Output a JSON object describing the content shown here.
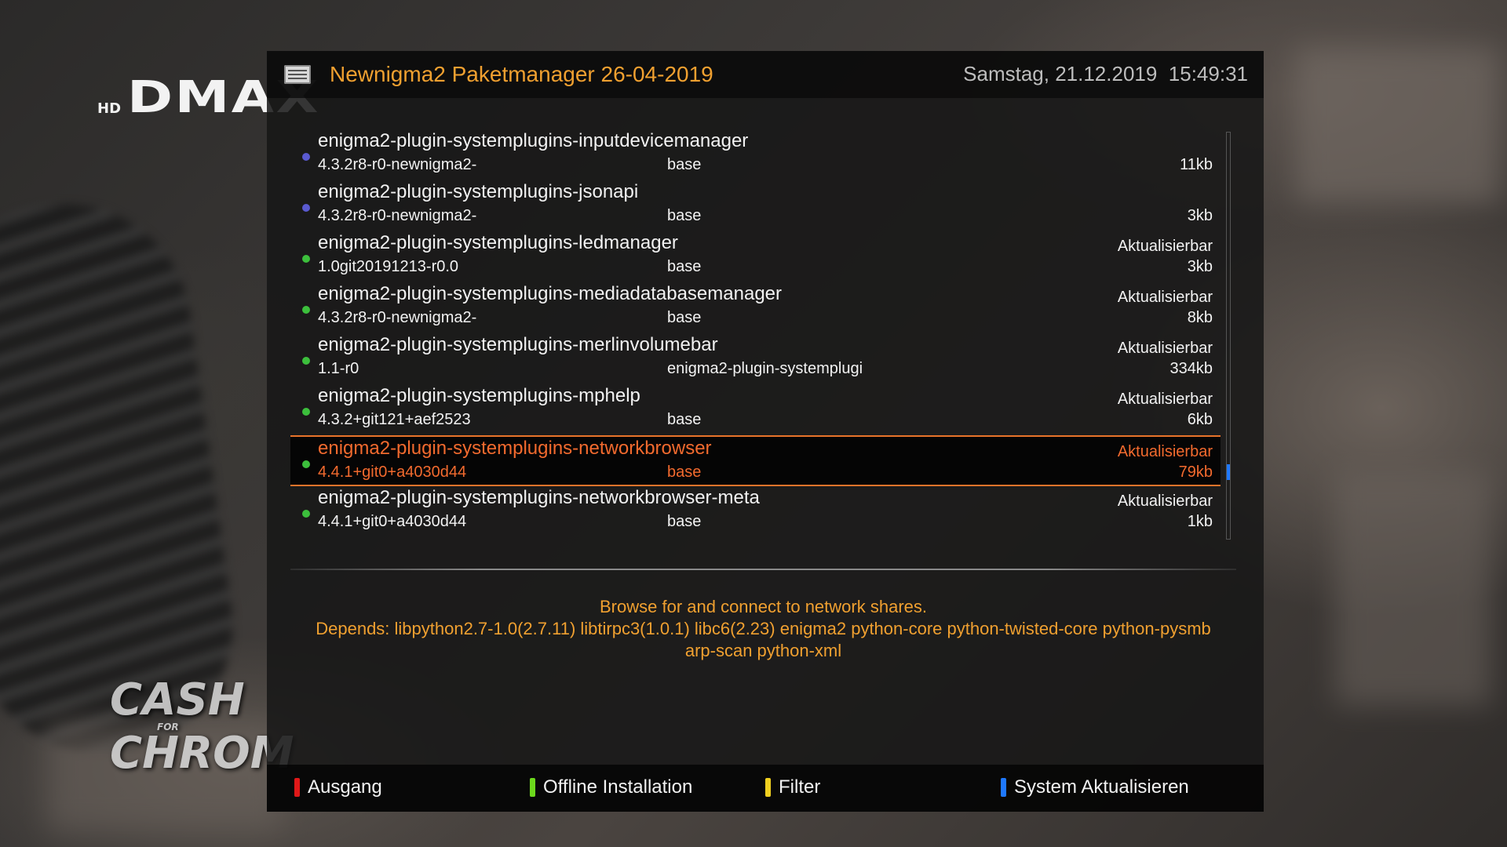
{
  "channel": {
    "hd_label": "HD",
    "brand": "DMAX",
    "show_logo_top": "CASH",
    "show_logo_small": "FOR",
    "show_logo_bottom": "CHROM"
  },
  "header": {
    "title": "Newnigma2 Paketmanager 26-04-2019",
    "date": "Samstag, 21.12.2019",
    "time": "15:49:31",
    "icon": "document-icon"
  },
  "packages": [
    {
      "name": "enigma2-plugin-systemplugins-inputdevicemanager",
      "version": "4.3.2r8-r0-newnigma2-",
      "section": "base",
      "status": "",
      "size": "11kb",
      "dot_color": "#5a5ad0"
    },
    {
      "name": "enigma2-plugin-systemplugins-jsonapi",
      "version": "4.3.2r8-r0-newnigma2-",
      "section": "base",
      "status": "",
      "size": "3kb",
      "dot_color": "#5a5ad0"
    },
    {
      "name": "enigma2-plugin-systemplugins-ledmanager",
      "version": "1.0git20191213-r0.0",
      "section": "base",
      "status": "Aktualisierbar",
      "size": "3kb",
      "dot_color": "#3cbf3c"
    },
    {
      "name": "enigma2-plugin-systemplugins-mediadatabasemanager",
      "version": "4.3.2r8-r0-newnigma2-",
      "section": "base",
      "status": "Aktualisierbar",
      "size": "8kb",
      "dot_color": "#3cbf3c"
    },
    {
      "name": "enigma2-plugin-systemplugins-merlinvolumebar",
      "version": "1.1-r0",
      "section": "enigma2-plugin-systemplugi",
      "status": "Aktualisierbar",
      "size": "334kb",
      "dot_color": "#3cbf3c"
    },
    {
      "name": "enigma2-plugin-systemplugins-mphelp",
      "version": "4.3.2+git121+aef2523",
      "section": "base",
      "status": "Aktualisierbar",
      "size": "6kb",
      "dot_color": "#3cbf3c"
    },
    {
      "name": "enigma2-plugin-systemplugins-networkbrowser",
      "version": "4.4.1+git0+a4030d44",
      "section": "base",
      "status": "Aktualisierbar",
      "size": "79kb",
      "dot_color": "#3cbf3c",
      "selected": true
    },
    {
      "name": "enigma2-plugin-systemplugins-networkbrowser-meta",
      "version": "4.4.1+git0+a4030d44",
      "section": "base",
      "status": "Aktualisierbar",
      "size": "1kb",
      "dot_color": "#3cbf3c"
    }
  ],
  "scroll_position": 0.85,
  "description": {
    "line1": "Browse for and connect to network shares.",
    "line2": "Depends: libpython2.7-1.0(2.7.11) libtirpc3(1.0.1) libc6(2.23) enigma2 python-core python-twisted-core python-pysmb arp-scan python-xml"
  },
  "footer": {
    "red_label": "Ausgang",
    "green_label": "Offline Installation",
    "yellow_label": "Filter",
    "blue_label": "System Aktualisieren",
    "colors": {
      "red": "#e01818",
      "green": "#6cd81c",
      "yellow": "#f0d020",
      "blue": "#1e78ff"
    }
  },
  "accent_color": "#f0a030",
  "selection_color": "#f26a2e"
}
